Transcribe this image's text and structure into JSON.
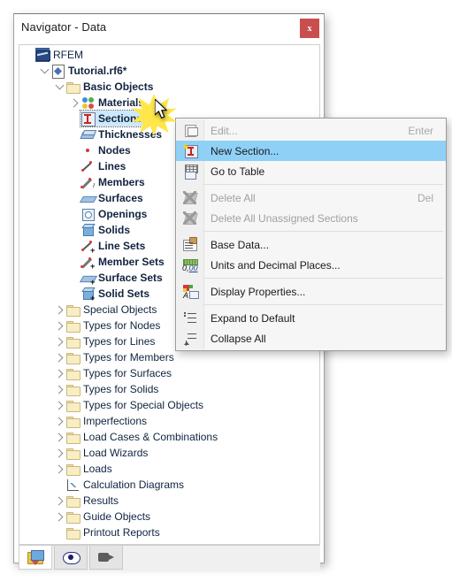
{
  "window": {
    "title": "Navigator - Data",
    "close_label": "x",
    "accent_close_color": "#c94f4f"
  },
  "tree": {
    "selection_color": "#cde8fb",
    "items": [
      {
        "label": "RFEM",
        "indent": 0,
        "icon": "rfem-flag-icon",
        "expander": "none",
        "bold": false,
        "selected": false
      },
      {
        "label": "Tutorial.rf6*",
        "indent": 1,
        "icon": "model-file-icon",
        "expander": "down",
        "bold": true,
        "selected": false
      },
      {
        "label": "Basic Objects",
        "indent": 2,
        "icon": "folder-icon",
        "expander": "down",
        "bold": true,
        "selected": false
      },
      {
        "label": "Materials",
        "indent": 3,
        "icon": "materials-icon",
        "expander": "right",
        "bold": true,
        "selected": false
      },
      {
        "label": "Sections",
        "indent": 3,
        "icon": "section-icon",
        "expander": "none",
        "bold": true,
        "selected": true
      },
      {
        "label": "Thicknesses",
        "indent": 3,
        "icon": "thickness-icon",
        "expander": "none",
        "bold": true,
        "selected": false
      },
      {
        "label": "Nodes",
        "indent": 3,
        "icon": "node-icon",
        "expander": "none",
        "bold": true,
        "selected": false
      },
      {
        "label": "Lines",
        "indent": 3,
        "icon": "line-icon",
        "expander": "none",
        "bold": true,
        "selected": false
      },
      {
        "label": "Members",
        "indent": 3,
        "icon": "member-icon",
        "expander": "none",
        "bold": true,
        "selected": false
      },
      {
        "label": "Surfaces",
        "indent": 3,
        "icon": "surface-icon",
        "expander": "none",
        "bold": true,
        "selected": false
      },
      {
        "label": "Openings",
        "indent": 3,
        "icon": "opening-icon",
        "expander": "none",
        "bold": true,
        "selected": false
      },
      {
        "label": "Solids",
        "indent": 3,
        "icon": "solid-icon",
        "expander": "none",
        "bold": true,
        "selected": false
      },
      {
        "label": "Line Sets",
        "indent": 3,
        "icon": "line-set-icon",
        "expander": "none",
        "bold": true,
        "selected": false
      },
      {
        "label": "Member Sets",
        "indent": 3,
        "icon": "member-set-icon",
        "expander": "none",
        "bold": true,
        "selected": false
      },
      {
        "label": "Surface Sets",
        "indent": 3,
        "icon": "surface-set-icon",
        "expander": "none",
        "bold": true,
        "selected": false
      },
      {
        "label": "Solid Sets",
        "indent": 3,
        "icon": "solid-set-icon",
        "expander": "none",
        "bold": true,
        "selected": false
      },
      {
        "label": "Special Objects",
        "indent": 2,
        "icon": "folder-icon",
        "expander": "right",
        "bold": false,
        "selected": false
      },
      {
        "label": "Types for Nodes",
        "indent": 2,
        "icon": "folder-icon",
        "expander": "right",
        "bold": false,
        "selected": false
      },
      {
        "label": "Types for Lines",
        "indent": 2,
        "icon": "folder-icon",
        "expander": "right",
        "bold": false,
        "selected": false
      },
      {
        "label": "Types for Members",
        "indent": 2,
        "icon": "folder-icon",
        "expander": "right",
        "bold": false,
        "selected": false
      },
      {
        "label": "Types for Surfaces",
        "indent": 2,
        "icon": "folder-icon",
        "expander": "right",
        "bold": false,
        "selected": false
      },
      {
        "label": "Types for Solids",
        "indent": 2,
        "icon": "folder-icon",
        "expander": "right",
        "bold": false,
        "selected": false
      },
      {
        "label": "Types for Special Objects",
        "indent": 2,
        "icon": "folder-icon",
        "expander": "right",
        "bold": false,
        "selected": false
      },
      {
        "label": "Imperfections",
        "indent": 2,
        "icon": "folder-icon",
        "expander": "right",
        "bold": false,
        "selected": false
      },
      {
        "label": "Load Cases & Combinations",
        "indent": 2,
        "icon": "folder-icon",
        "expander": "right",
        "bold": false,
        "selected": false
      },
      {
        "label": "Load Wizards",
        "indent": 2,
        "icon": "folder-icon",
        "expander": "right",
        "bold": false,
        "selected": false
      },
      {
        "label": "Loads",
        "indent": 2,
        "icon": "folder-icon",
        "expander": "right",
        "bold": false,
        "selected": false
      },
      {
        "label": "Calculation Diagrams",
        "indent": 2,
        "icon": "calculation-diagram-icon",
        "expander": "none",
        "bold": false,
        "selected": false
      },
      {
        "label": "Results",
        "indent": 2,
        "icon": "folder-icon",
        "expander": "right",
        "bold": false,
        "selected": false
      },
      {
        "label": "Guide Objects",
        "indent": 2,
        "icon": "folder-icon",
        "expander": "right",
        "bold": false,
        "selected": false
      },
      {
        "label": "Printout Reports",
        "indent": 2,
        "icon": "folder-icon",
        "expander": "none",
        "bold": false,
        "selected": false
      }
    ]
  },
  "tabs": [
    {
      "name": "data-navigator-tab",
      "icon": "data-navigator-icon",
      "active": true
    },
    {
      "name": "display-navigator-tab",
      "icon": "eye-icon",
      "active": false
    },
    {
      "name": "views-navigator-tab",
      "icon": "camera-icon",
      "active": false
    }
  ],
  "context_menu": {
    "highlight_color": "#8fd0f7",
    "items": [
      {
        "label": "Edit...",
        "accel": "Enter",
        "icon": "edit-icon",
        "disabled": true,
        "highlighted": false,
        "sep_after": false
      },
      {
        "label": "New Section...",
        "accel": "",
        "icon": "new-section-icon",
        "disabled": false,
        "highlighted": true,
        "sep_after": false
      },
      {
        "label": "Go to Table",
        "accel": "",
        "icon": "go-to-table-icon",
        "disabled": false,
        "highlighted": false,
        "sep_after": true
      },
      {
        "label": "Delete All",
        "accel": "Del",
        "icon": "delete-icon",
        "disabled": true,
        "highlighted": false,
        "sep_after": false
      },
      {
        "label": "Delete All Unassigned Sections",
        "accel": "",
        "icon": "delete-icon",
        "disabled": true,
        "highlighted": false,
        "sep_after": true
      },
      {
        "label": "Base Data...",
        "accel": "",
        "icon": "base-data-icon",
        "disabled": false,
        "highlighted": false,
        "sep_after": false
      },
      {
        "label": "Units and Decimal Places...",
        "accel": "",
        "icon": "units-icon",
        "disabled": false,
        "highlighted": false,
        "sep_after": true
      },
      {
        "label": "Display Properties...",
        "accel": "",
        "icon": "display-properties-icon",
        "disabled": false,
        "highlighted": false,
        "sep_after": true
      },
      {
        "label": "Expand to Default",
        "accel": "",
        "icon": "expand-icon",
        "disabled": false,
        "highlighted": false,
        "sep_after": false
      },
      {
        "label": "Collapse All",
        "accel": "",
        "icon": "collapse-icon",
        "disabled": false,
        "highlighted": false,
        "sep_after": false
      }
    ]
  },
  "pointer": {
    "icon": "mouse-cursor-icon",
    "highlight": "click-starburst"
  }
}
